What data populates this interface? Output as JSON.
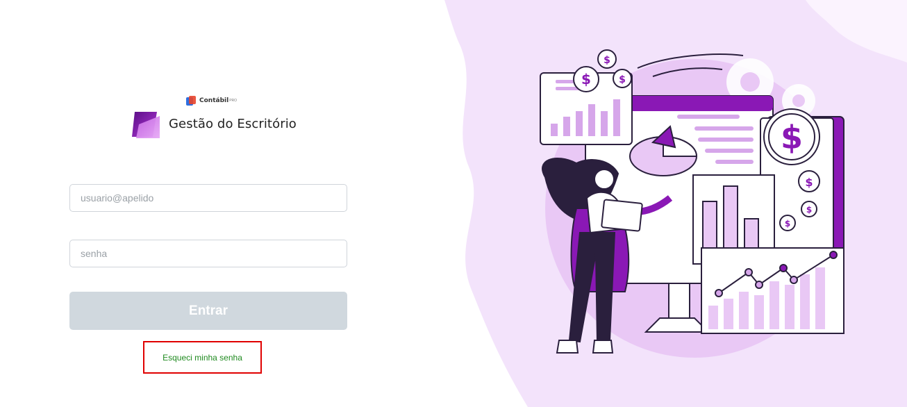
{
  "brand": {
    "parent_name": "Contábil",
    "parent_sup": "PRO",
    "app_name": "Gestão do Escritório"
  },
  "login": {
    "user_placeholder": "usuario@apelido",
    "password_placeholder": "senha",
    "submit_label": "Entrar",
    "forgot_label": "Esqueci minha senha"
  },
  "colors": {
    "accent_purple": "#8a18b5",
    "bg_lavender": "#f3e3fb",
    "button_disabled": "#d0d8de",
    "link_green": "#1f8a1f",
    "highlight_red": "#e00000"
  }
}
